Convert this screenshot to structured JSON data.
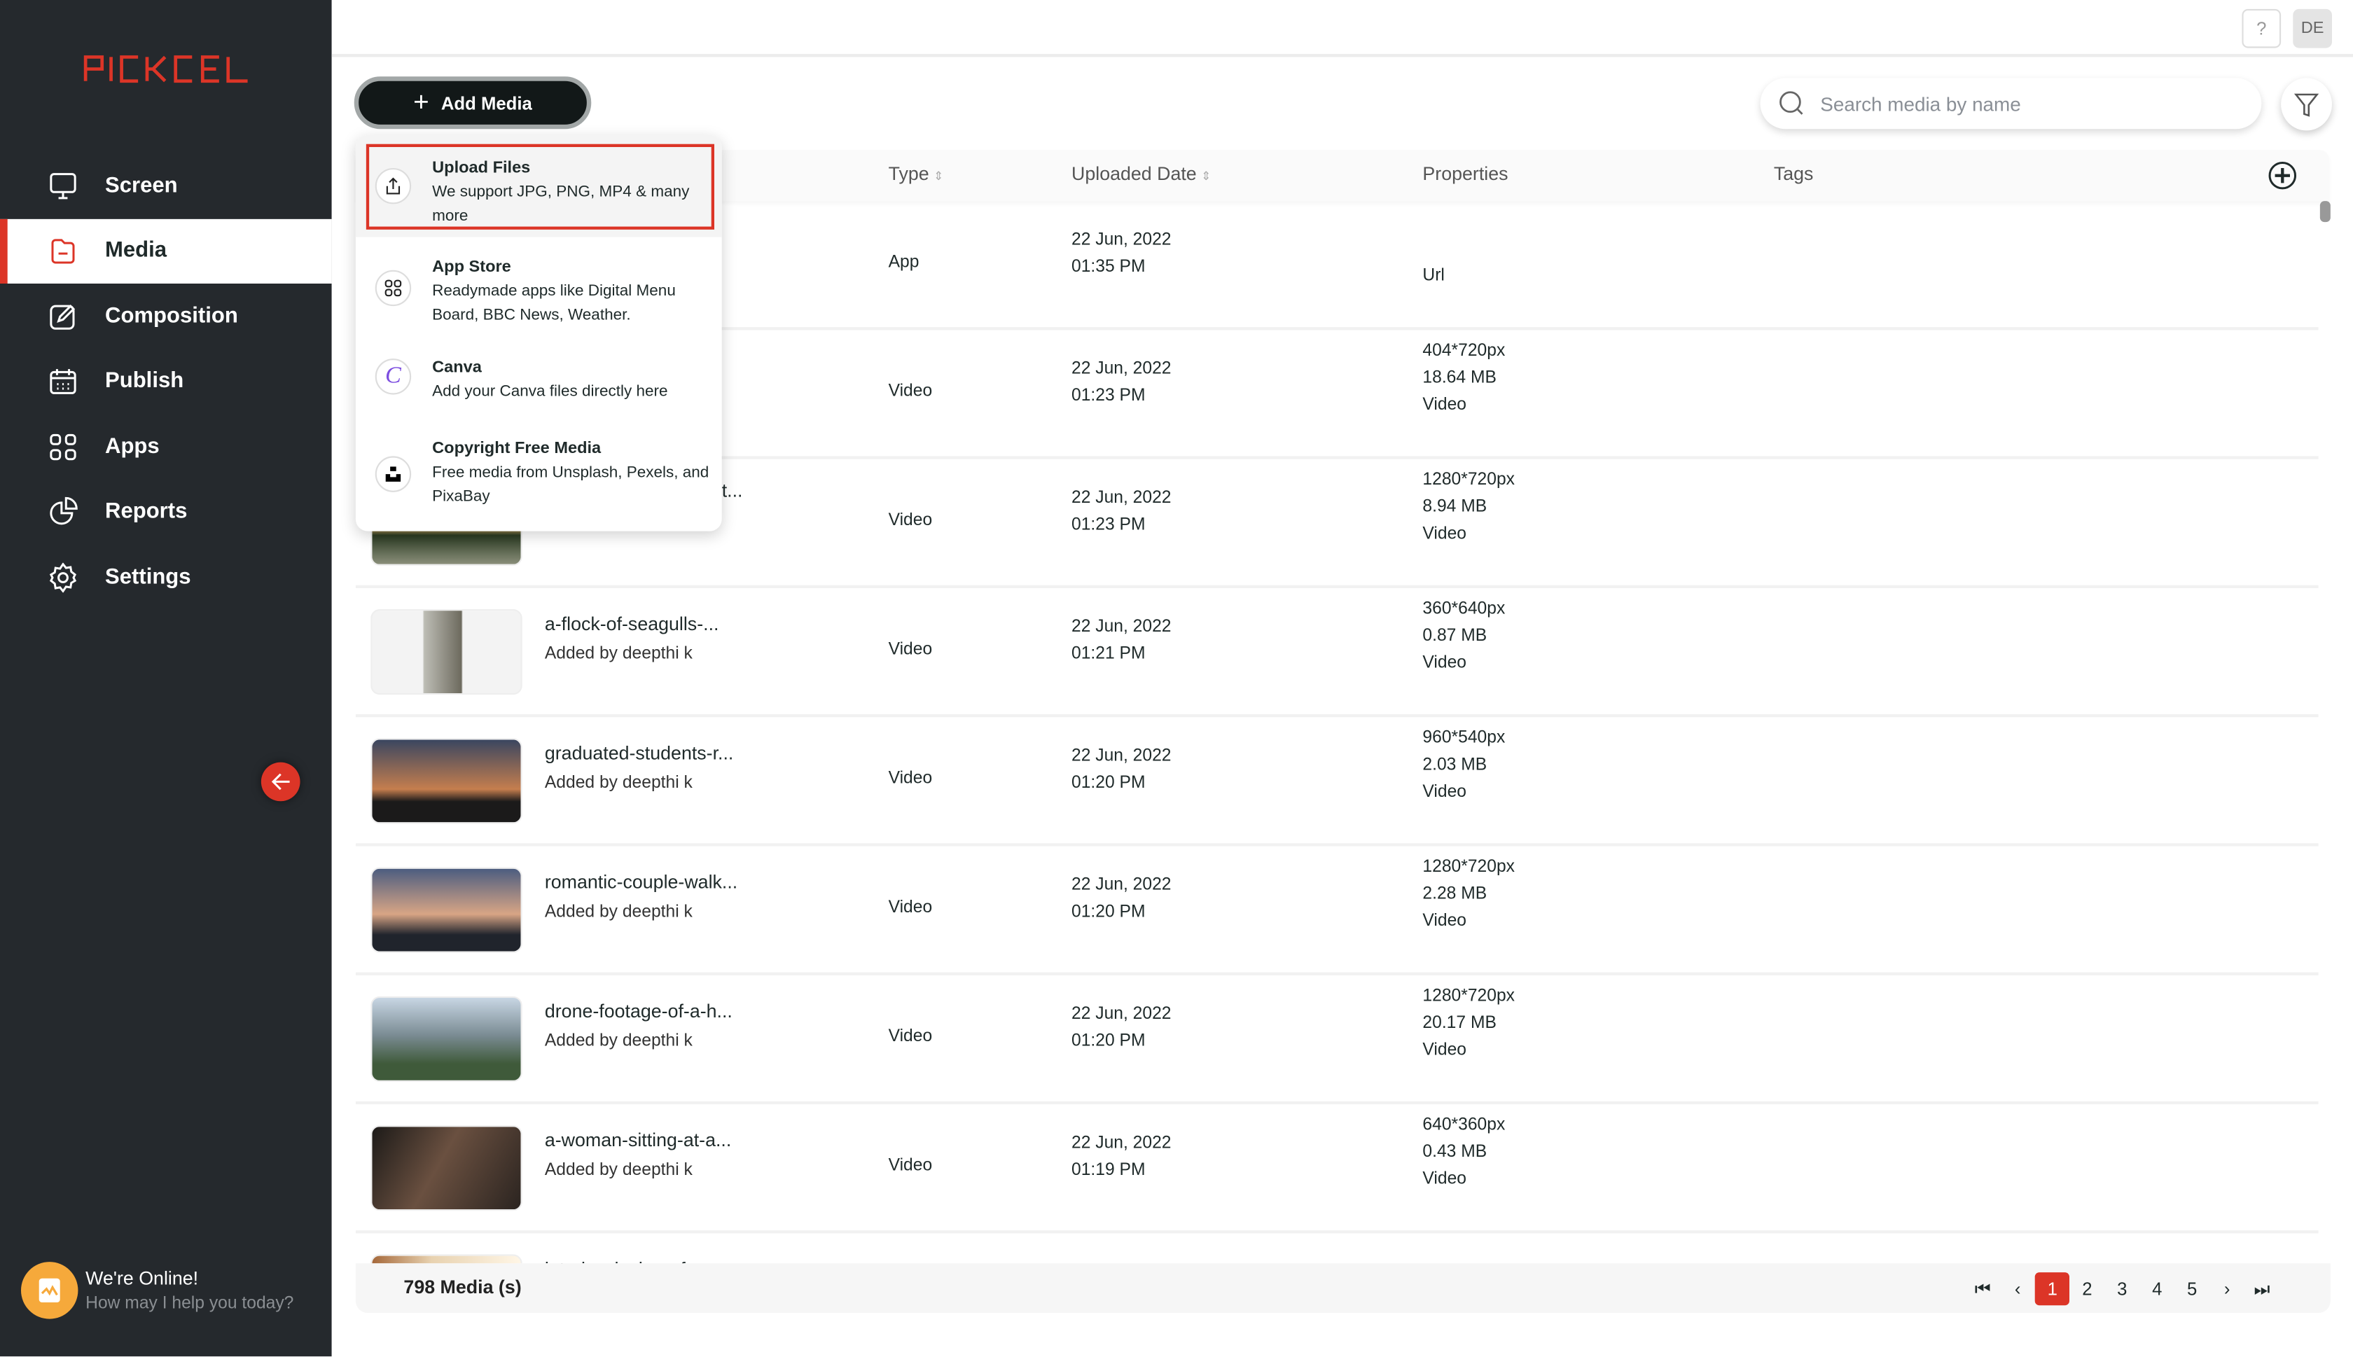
{
  "brand": {
    "logo_text": "PICKCEL",
    "accent": "#dc3527",
    "sidebar_bg": "#25292d"
  },
  "sidebar": {
    "items": [
      {
        "label": "Screen",
        "icon": "monitor-icon"
      },
      {
        "label": "Media",
        "icon": "folder-icon",
        "active": true
      },
      {
        "label": "Composition",
        "icon": "edit-icon"
      },
      {
        "label": "Publish",
        "icon": "calendar-icon"
      },
      {
        "label": "Apps",
        "icon": "grid-icon"
      },
      {
        "label": "Reports",
        "icon": "pie-chart-icon"
      },
      {
        "label": "Settings",
        "icon": "gear-icon"
      }
    ]
  },
  "chat": {
    "title": "We're Online!",
    "subtitle": "How may I help you today?"
  },
  "topbar": {
    "help": "?",
    "avatar": "DE"
  },
  "toolbar": {
    "add_media": "Add Media",
    "search_placeholder": "Search media by name"
  },
  "dropdown": [
    {
      "title": "Upload Files",
      "desc": "We support JPG, PNG, MP4 & many more",
      "icon": "upload-icon",
      "highlighted": true
    },
    {
      "title": "App Store",
      "desc": "Readymade apps like Digital Menu Board, BBC News, Weather.",
      "icon": "apps-grid-icon"
    },
    {
      "title": "Canva",
      "desc": "Add your Canva files directly here",
      "icon": "canva-icon"
    },
    {
      "title": "Copyright Free Media",
      "desc": "Free media from Unsplash, Pexels, and PixaBay",
      "icon": "unsplash-icon"
    }
  ],
  "table": {
    "columns": {
      "type": "Type",
      "date": "Uploaded Date",
      "properties": "Properties",
      "tags": "Tags"
    },
    "rows": [
      {
        "name": "",
        "by": "",
        "type": "App",
        "date": "22 Jun, 2022",
        "time": "01:35 PM",
        "props": [
          "",
          "",
          "Url"
        ]
      },
      {
        "name": "",
        "by": "",
        "type": "Video",
        "date": "22 Jun, 2022",
        "time": "01:23 PM",
        "props": [
          "404*720px",
          "18.64 MB",
          "Video"
        ]
      },
      {
        "name": "t...",
        "by": "",
        "type": "Video",
        "date": "22 Jun, 2022",
        "time": "01:23 PM",
        "props": [
          "1280*720px",
          "8.94 MB",
          "Video"
        ]
      },
      {
        "name": "a-flock-of-seagulls-...",
        "by": "Added by deepthi k",
        "type": "Video",
        "date": "22 Jun, 2022",
        "time": "01:21 PM",
        "props": [
          "360*640px",
          "0.87 MB",
          "Video"
        ]
      },
      {
        "name": "graduated-students-r...",
        "by": "Added by deepthi k",
        "type": "Video",
        "date": "22 Jun, 2022",
        "time": "01:20 PM",
        "props": [
          "960*540px",
          "2.03 MB",
          "Video"
        ]
      },
      {
        "name": "romantic-couple-walk...",
        "by": "Added by deepthi k",
        "type": "Video",
        "date": "22 Jun, 2022",
        "time": "01:20 PM",
        "props": [
          "1280*720px",
          "2.28 MB",
          "Video"
        ]
      },
      {
        "name": "drone-footage-of-a-h...",
        "by": "Added by deepthi k",
        "type": "Video",
        "date": "22 Jun, 2022",
        "time": "01:20 PM",
        "props": [
          "1280*720px",
          "20.17 MB",
          "Video"
        ]
      },
      {
        "name": "a-woman-sitting-at-a...",
        "by": "Added by deepthi k",
        "type": "Video",
        "date": "22 Jun, 2022",
        "time": "01:19 PM",
        "props": [
          "640*360px",
          "0.43 MB",
          "Video"
        ]
      },
      {
        "name": "interior-design-of-a...",
        "by": "",
        "type": "",
        "date": "",
        "time": "",
        "props": [
          "",
          "",
          ""
        ]
      }
    ]
  },
  "footer": {
    "count": "798 Media (s)",
    "pages": [
      "1",
      "2",
      "3",
      "4",
      "5"
    ],
    "current_page": "1"
  }
}
